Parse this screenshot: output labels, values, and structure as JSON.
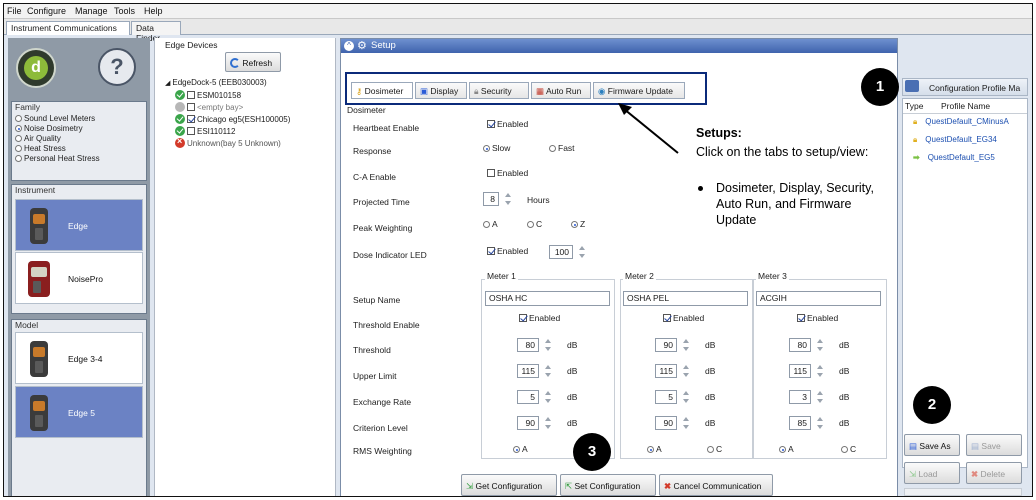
{
  "menu": [
    "File",
    "Configure",
    "Manage",
    "Tools",
    "Help"
  ],
  "top_tabs": [
    "Instrument Communications",
    "Data Finder"
  ],
  "left": {
    "family_title": "Family",
    "families": [
      {
        "label": "Sound Level Meters",
        "selected": false
      },
      {
        "label": "Noise Dosimetry",
        "selected": true
      },
      {
        "label": "Air Quality",
        "selected": false
      },
      {
        "label": "Heat Stress",
        "selected": false
      },
      {
        "label": "Personal Heat Stress",
        "selected": false
      }
    ],
    "instrument_title": "Instrument",
    "instruments": [
      {
        "label": "Edge",
        "selected": true
      },
      {
        "label": "NoisePro",
        "selected": false
      }
    ],
    "model_title": "Model",
    "models": [
      {
        "label": "Edge 3-4",
        "selected": false
      },
      {
        "label": "Edge 5",
        "selected": true
      }
    ]
  },
  "edge": {
    "title": "Edge Devices",
    "refresh": "Refresh",
    "root": "EdgeDock-5 (EEB030003)",
    "items": [
      {
        "label": "ESM010158",
        "status": "ok",
        "checked": false
      },
      {
        "label": "<empty bay>",
        "status": "empty",
        "checked": false
      },
      {
        "label": "Chicago eg5(ESH100005)",
        "status": "ok",
        "checked": true
      },
      {
        "label": "ESI110112",
        "status": "ok",
        "checked": false
      },
      {
        "label": "Unknown(bay 5 Unknown)",
        "status": "err",
        "checked": false
      }
    ]
  },
  "setup": {
    "title": "Setup",
    "tabs": [
      "Dosimeter",
      "Display",
      "Security",
      "Auto Run",
      "Firmware Update"
    ],
    "section": "Dosimeter",
    "heartbeat_label": "Heartbeat Enable",
    "enabled": "Enabled",
    "response_label": "Response",
    "response_options": [
      "Slow",
      "Fast"
    ],
    "ca_label": "C-A Enable",
    "projected_label": "Projected Time",
    "projected_value": "8",
    "projected_unit": "Hours",
    "peak_label": "Peak Weighting",
    "peak_options": [
      "A",
      "C",
      "Z"
    ],
    "dose_label": "Dose Indicator LED",
    "dose_value": "100",
    "meters": [
      {
        "title": "Meter 1",
        "name": "OSHA HC",
        "threshold": "80",
        "upper": "115",
        "exchange": "5",
        "criterion": "90",
        "rms": "A"
      },
      {
        "title": "Meter 2",
        "name": "OSHA PEL",
        "threshold": "90",
        "upper": "115",
        "exchange": "5",
        "criterion": "90",
        "rms": "A"
      },
      {
        "title": "Meter 3",
        "name": "ACGIH",
        "threshold": "80",
        "upper": "115",
        "exchange": "3",
        "criterion": "85",
        "rms": "A"
      }
    ],
    "row_labels": {
      "setup_name": "Setup Name",
      "threshold_enable": "Threshold Enable",
      "threshold": "Threshold",
      "upper": "Upper Limit",
      "exchange": "Exchange Rate",
      "criterion": "Criterion Level",
      "rms": "RMS Weighting"
    },
    "unit": "dB",
    "rms_options": [
      "A",
      "C"
    ],
    "get_config": "Get Configuration",
    "set_config": "Set Configuration",
    "cancel_comm": "Cancel Communication"
  },
  "profiles": {
    "title": "Configuration Profile Ma",
    "col_type": "Type",
    "col_name": "Profile Name",
    "items": [
      {
        "name": "QuestDefault_CMinusA",
        "icon": "lock-icon"
      },
      {
        "name": "QuestDefault_EG34",
        "icon": "lock-icon"
      },
      {
        "name": "QuestDefault_EG5",
        "icon": "arrow-right-icon"
      }
    ],
    "save_as": "Save As",
    "save": "Save",
    "load": "Load",
    "delete": "Delete"
  },
  "annotation": {
    "title": "Setups:",
    "line1": "Click on the tabs to setup/view:",
    "bullet": "Dosimeter,  Display, Security, Auto Run, and Firmware Update"
  },
  "callouts": [
    "1",
    "2",
    "3"
  ],
  "colors": {
    "accent": "#3f63ad",
    "selected": "#6b82c4",
    "highlight": "#0b2a7a"
  }
}
